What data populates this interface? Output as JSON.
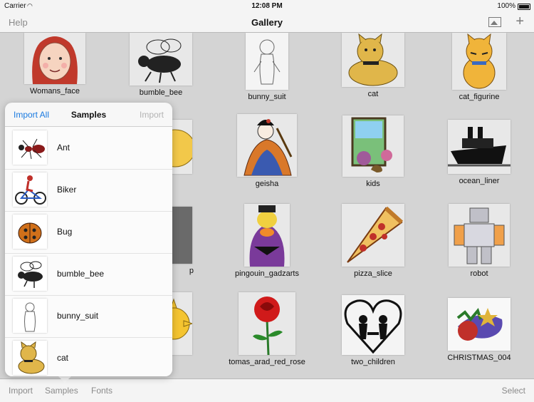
{
  "status_bar": {
    "carrier": "Carrier",
    "wifi_icon": "wifi-icon",
    "time": "12:08 PM",
    "battery": "100%"
  },
  "nav": {
    "left_button": "Help",
    "title": "Gallery",
    "right_icons": [
      "image-icon",
      "plus-icon"
    ]
  },
  "gallery": {
    "items": [
      {
        "label": "Womans_face"
      },
      {
        "label": "bumble_bee"
      },
      {
        "label": "bunny_suit"
      },
      {
        "label": "cat"
      },
      {
        "label": "cat_figurine"
      },
      {
        "label": ""
      },
      {
        "label": ""
      },
      {
        "label": "geisha"
      },
      {
        "label": "kids"
      },
      {
        "label": "ocean_liner"
      },
      {
        "label": ""
      },
      {
        "label": "p"
      },
      {
        "label": "pingouin_gadzarts"
      },
      {
        "label": "pizza_slice"
      },
      {
        "label": "robot"
      },
      {
        "label": ""
      },
      {
        "label": ""
      },
      {
        "label": "tomas_arad_red_rose"
      },
      {
        "label": "two_children"
      },
      {
        "label": "CHRISTMAS_004"
      }
    ]
  },
  "popover": {
    "import_all": "Import All",
    "title": "Samples",
    "import": "Import",
    "items": [
      {
        "label": "Ant"
      },
      {
        "label": "Biker"
      },
      {
        "label": "Bug"
      },
      {
        "label": "bumble_bee"
      },
      {
        "label": "bunny_suit"
      },
      {
        "label": "cat"
      }
    ]
  },
  "toolbar": {
    "import": "Import",
    "samples": "Samples",
    "fonts": "Fonts",
    "select": "Select"
  }
}
